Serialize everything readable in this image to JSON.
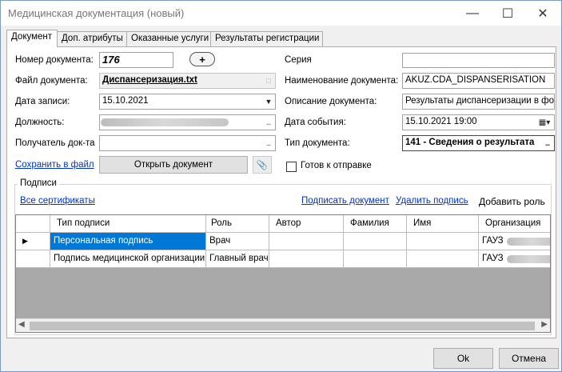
{
  "window": {
    "title": "Медицинская документация (новый)"
  },
  "tabs": [
    {
      "label": "Документ"
    },
    {
      "label": "Доп. атрибуты"
    },
    {
      "label": "Оказанные услуги"
    },
    {
      "label": "Результаты регистрации"
    }
  ],
  "form": {
    "doc_number_label": "Номер документа:",
    "doc_number_value": "176",
    "add_button": "+",
    "series_label": "Серия",
    "series_value": "",
    "file_label": "Файл документа:",
    "file_value": "Диспансеризация.txt",
    "doc_name_label": "Наименование документа:",
    "doc_name_value": "AKUZ.CDA_DISPANSERISATION",
    "record_date_label": "Дата записи:",
    "record_date_value": "15.10.2021",
    "description_label": "Описание документа:",
    "description_value": "Результаты диспансеризации в фор",
    "position_label": "Должность:",
    "event_date_label": "Дата события:",
    "event_date_value": "15.10.2021 19:00",
    "recipient_label": "Получатель док-та",
    "doc_type_label": "Тип документа:",
    "doc_type_value": "141 - Сведения о результата",
    "save_link": "Сохранить в файл",
    "open_button": "Открыть документ",
    "ready_label": "Готов к отправке"
  },
  "signatures": {
    "group_label": "Подписи",
    "all_certs_link": "Все сертификаты",
    "sign_link": "Подписать документ",
    "delete_link": "Удалить подпись",
    "add_role_link": "Добавить роль",
    "columns": [
      "Тип подписи",
      "Роль",
      "Автор",
      "Фамилия",
      "Имя",
      "Организация"
    ],
    "rows": [
      {
        "type": "Персональная подпись",
        "role": "Врач",
        "author": "",
        "surname": "",
        "name": "",
        "org": "ГАУЗ"
      },
      {
        "type": "Подпись медицинской организации",
        "role": "Главный врач",
        "author": "",
        "surname": "",
        "name": "",
        "org": "ГАУЗ"
      }
    ]
  },
  "buttons": {
    "ok": "Ok",
    "cancel": "Отмена"
  },
  "icons": {
    "minimize": "minimize-icon",
    "maximize": "maximize-icon",
    "close": "close-icon",
    "attach": "paperclip-icon",
    "calendar": "calendar-icon",
    "dropdown": "chevron-down-icon",
    "row_pointer": "row-pointer-icon"
  },
  "colors": {
    "selection": "#0078d7",
    "link": "#0033cc",
    "grid_background": "#a9a9a9"
  }
}
